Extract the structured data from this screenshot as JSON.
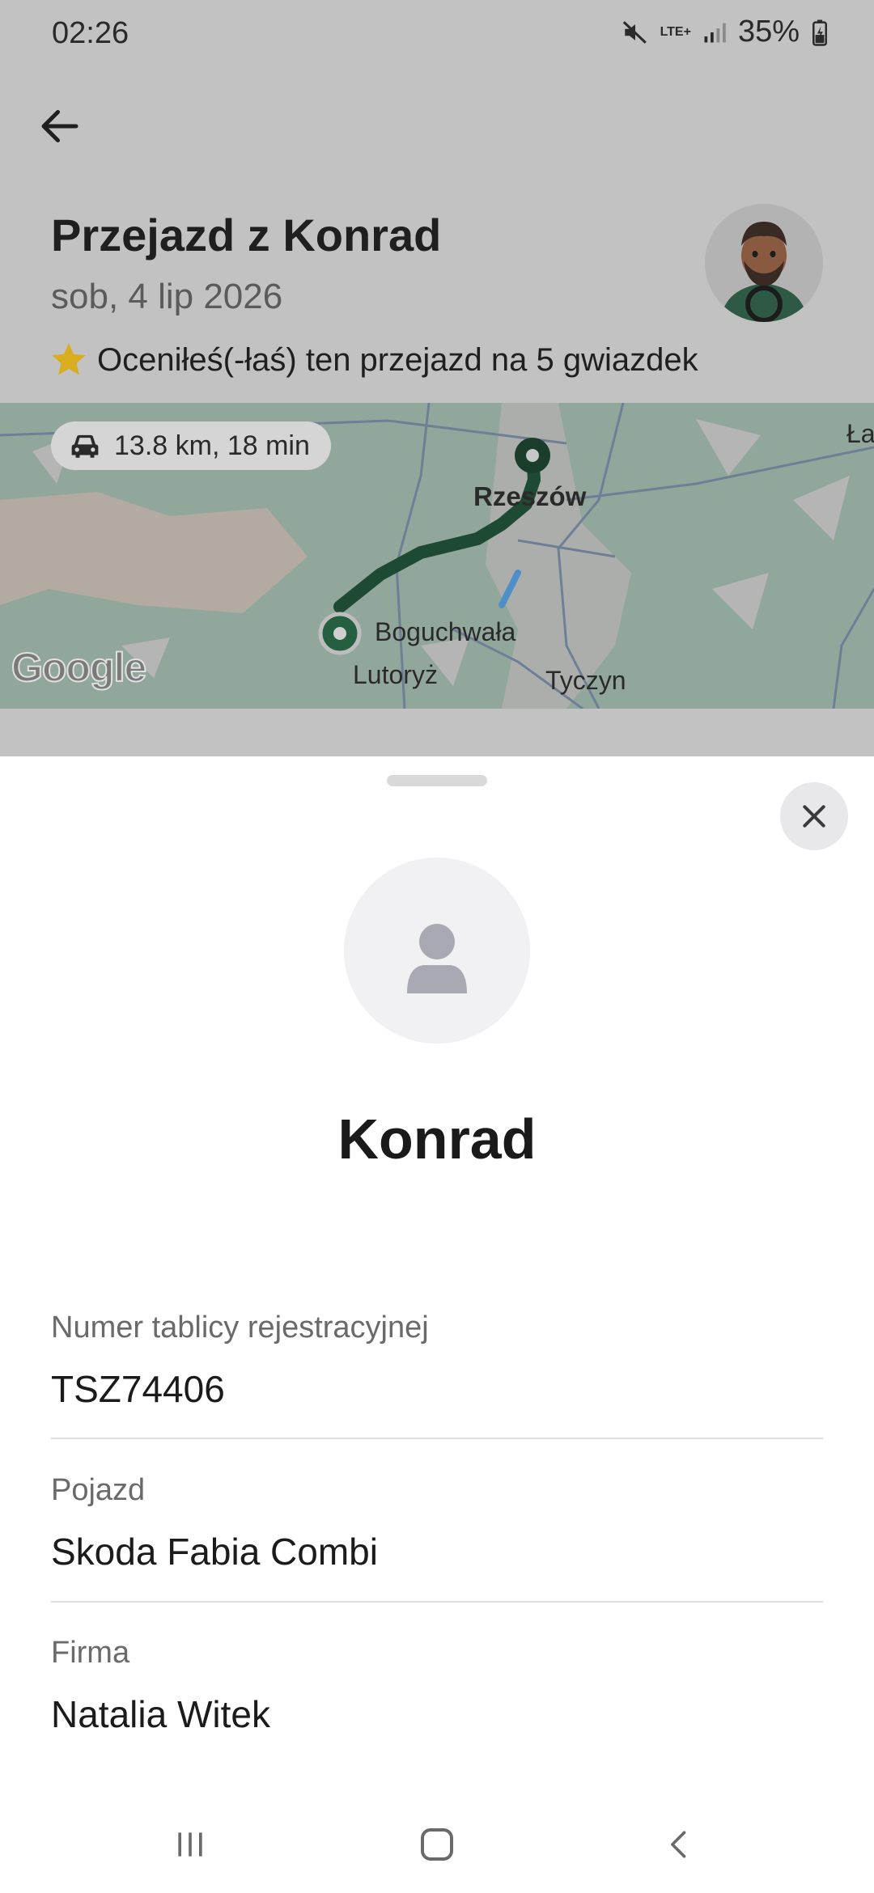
{
  "status_bar": {
    "time": "02:26",
    "network": "LTE+",
    "battery": "35%",
    "icons": [
      "mute-icon",
      "signal-icon",
      "battery-charging-icon"
    ]
  },
  "header": {
    "title": "Przejazd z Konrad",
    "date": "sob, 4 lip 2026",
    "rating_text": "Oceniłeś(-łaś) ten przejazd na 5 gwiazdek",
    "rating_icon": "star-icon"
  },
  "map": {
    "route_summary": "13.8 km, 18 min",
    "labels": {
      "city_main": "Rzeszów",
      "city_start": "Boguchwała",
      "town_1": "Lutoryż",
      "town_2": "Tyczyn",
      "edge_label": "Ła"
    },
    "attribution": "Google",
    "colors": {
      "land": "#92a79c",
      "route": "#1e4a33",
      "marker": "#245f3f"
    }
  },
  "sheet": {
    "driver_name": "Konrad",
    "fields": [
      {
        "label": "Numer tablicy rejestracyjnej",
        "value": "TSZ74406"
      },
      {
        "label": "Pojazd",
        "value": "Skoda Fabia Combi"
      },
      {
        "label": "Firma",
        "value": "Natalia Witek"
      }
    ]
  },
  "nav_bar": {
    "buttons": [
      "recent-apps-icon",
      "home-icon",
      "back-nav-icon"
    ]
  }
}
